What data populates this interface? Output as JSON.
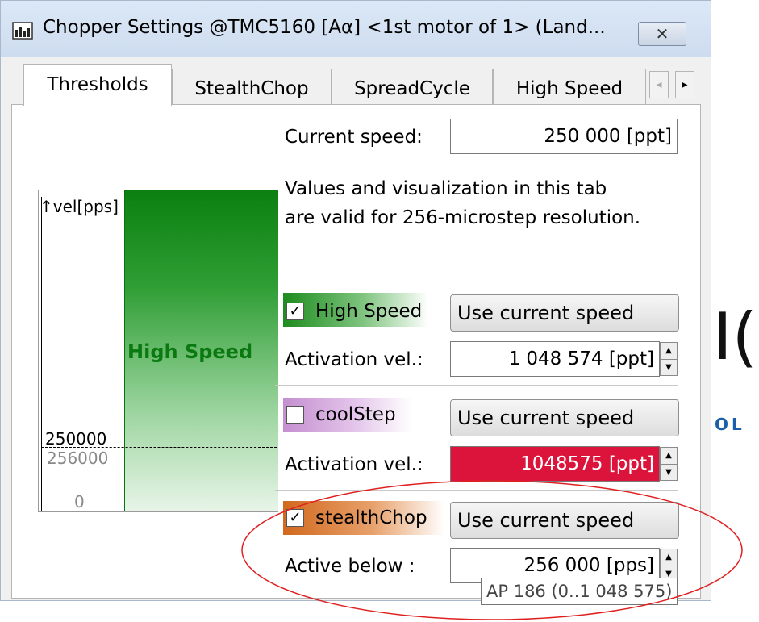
{
  "window": {
    "title": "Chopper Settings @TMC5160 [Aα] <1st motor of 1> (Land...",
    "close_symbol": "✕",
    "title_icon": "chart-bars-icon"
  },
  "tabs": [
    {
      "label": "Thresholds",
      "active": true
    },
    {
      "label": "StealthChop",
      "active": false
    },
    {
      "label": "SpreadCycle",
      "active": false
    },
    {
      "label": "High Speed",
      "active": false
    }
  ],
  "tab_scroll": {
    "left": "◂",
    "right": "▸"
  },
  "current_speed": {
    "label": "Current speed:",
    "value": "250 000 [ppt]"
  },
  "info_text": {
    "line1": "Values and visualization in this tab",
    "line2": "are valid for 256-microstep resolution."
  },
  "chart": {
    "y_axis_label": "↑vel[pps]",
    "region_label": "High Speed",
    "tick_current": "250000",
    "tick_stealth": "256000",
    "tick_zero": "0",
    "colors": {
      "high_speed": "#0a7a10",
      "high_speed_text": "#0a7a10"
    }
  },
  "high_speed": {
    "checked": true,
    "check_mark": "✓",
    "label": "High Speed",
    "button": "Use current speed",
    "field_label": "Activation vel.:",
    "field_value": "1 048 574 [ppt]",
    "accent": "#1e8c1e"
  },
  "coolstep": {
    "checked": false,
    "check_mark": "",
    "label": "coolStep",
    "button": "Use current speed",
    "field_label": "Activation vel.:",
    "field_value": "1048575 [ppt]",
    "field_bg": "#dc143c",
    "accent": "#c58fd0"
  },
  "stealthchop": {
    "checked": true,
    "check_mark": "✓",
    "label": "stealthChop",
    "button": "Use current speed",
    "field_label": "Active below :",
    "field_value": "256 000 [pps]",
    "accent": "#d2691e",
    "tooltip": "AP 186 (0..1 048 575)"
  },
  "spin": {
    "up": "▲",
    "down": "▼"
  },
  "background": {
    "logo_fragment": "I(",
    "logo_text_fragment": "OL"
  },
  "annotation_color": "#e02020"
}
